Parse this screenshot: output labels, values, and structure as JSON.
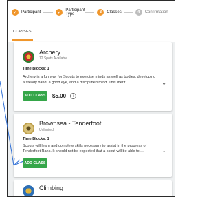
{
  "stepper": {
    "steps": [
      {
        "label": "Participant",
        "marker": "✓",
        "state": "done"
      },
      {
        "label": "Participant Type",
        "marker": "✓",
        "state": "done"
      },
      {
        "label": "Classes",
        "marker": "3",
        "state": "current"
      },
      {
        "label": "Confirmation",
        "marker": "4",
        "state": "todo"
      }
    ]
  },
  "tabs": {
    "active": "CLASSES"
  },
  "cards": [
    {
      "title": "Archery",
      "subtitle": "12 Spots Available",
      "time_blocks": "Time Blocks: 1",
      "description": "Archery is a fun way for Scouts to exercise minds as well as bodies, developing a steady hand, a good eye, and a disciplined mind. This merit...",
      "button": "ADD CLASS",
      "price": "$5.00",
      "info_icon": "info-icon",
      "expand_icon": "chevron-down-icon"
    },
    {
      "title": "Brownsea - Tenderfoot",
      "subtitle": "Unlimited",
      "time_blocks": "Time Blocks: 1",
      "description": "Scouts will learn and complete skills necessary to assist in the progress of Tenderfoot Rank. It should not be expected that a scout will be able to ...",
      "button": "ADD CLASS",
      "expand_icon": "chevron-down-icon"
    },
    {
      "title": "Climbing"
    }
  ],
  "colors": {
    "accent": "#f0962b",
    "add_button": "#35a649",
    "arrow": "#2f6fd6"
  }
}
